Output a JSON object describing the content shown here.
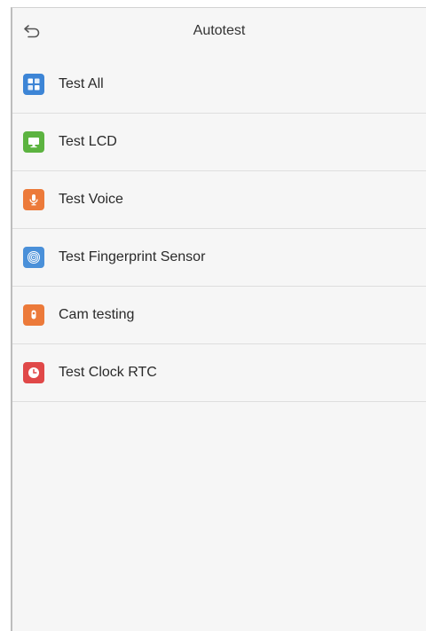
{
  "header": {
    "title": "Autotest"
  },
  "items": [
    {
      "label": "Test All",
      "icon": "grid-icon",
      "color": "#3d85d6"
    },
    {
      "label": "Test LCD",
      "icon": "monitor-icon",
      "color": "#5cb340"
    },
    {
      "label": "Test Voice",
      "icon": "microphone-icon",
      "color": "#ec7a3a"
    },
    {
      "label": "Test Fingerprint Sensor",
      "icon": "fingerprint-icon",
      "color": "#4a90d9"
    },
    {
      "label": "Cam testing",
      "icon": "camera-icon",
      "color": "#ec7a3a"
    },
    {
      "label": "Test Clock RTC",
      "icon": "clock-icon",
      "color": "#e04848"
    }
  ]
}
